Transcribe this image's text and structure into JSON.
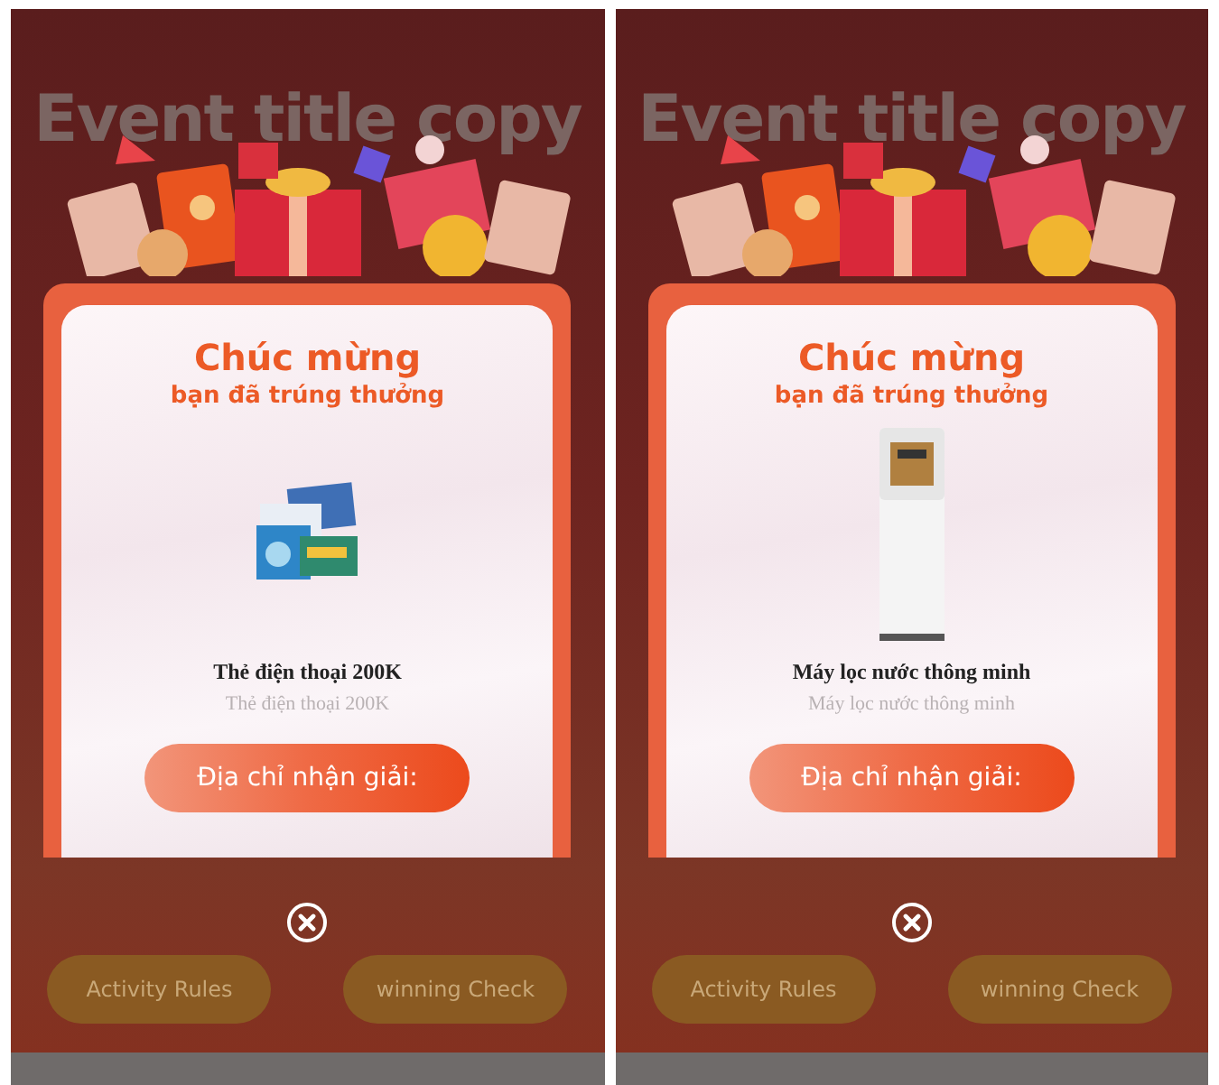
{
  "screens": [
    {
      "title": "Event title copy",
      "heading": "Chúc mừng",
      "subheading": "bạn đã trúng thưởng",
      "prize": {
        "kind": "picture",
        "name": "Thẻ điện thoại 200K",
        "description": "Thẻ điện thoại 200K"
      },
      "claim_button": "Địa chỉ nhận giải:",
      "buttons": [
        "Activity Rules",
        "winning Check"
      ]
    },
    {
      "title": "Event title copy",
      "heading": "Chúc mừng",
      "subheading": "bạn đã trúng thưởng",
      "prize": {
        "kind": "picture",
        "name": "Máy lọc nước thông minh",
        "description": "Máy lọc nước thông minh"
      },
      "claim_button": "Địa chỉ nhận giải:",
      "buttons": [
        "Activity Rules",
        "winning Check"
      ]
    }
  ]
}
